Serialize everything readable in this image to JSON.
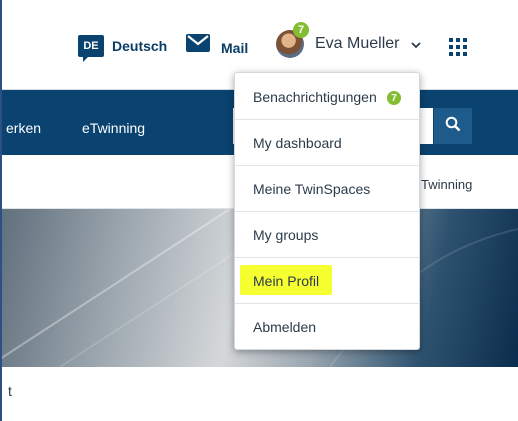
{
  "header": {
    "language": {
      "code": "DE",
      "label": "Deutsch"
    },
    "mail_label": "Mail",
    "user": {
      "name": "Eva Mueller",
      "notification_count": "7"
    }
  },
  "nav": {
    "items": [
      {
        "label": "erken"
      },
      {
        "label": "eTwinning"
      }
    ]
  },
  "subnav": {
    "partial_link": "Twinning"
  },
  "content": {
    "partial_text": "t"
  },
  "user_menu": {
    "items": [
      {
        "label": "Benachrichtigungen",
        "badge": "7"
      },
      {
        "label": "My dashboard"
      },
      {
        "label": "Meine TwinSpaces"
      },
      {
        "label": "My groups"
      },
      {
        "label": "Mein Profil",
        "highlighted": true
      },
      {
        "label": "Abmelden"
      }
    ]
  },
  "colors": {
    "brand_navy": "#0a4270",
    "badge_green": "#82bd32",
    "highlight_yellow": "#f6ff2f"
  },
  "icons": [
    "mail-icon",
    "chevron-down-icon",
    "apps-grid-icon",
    "search-icon"
  ]
}
